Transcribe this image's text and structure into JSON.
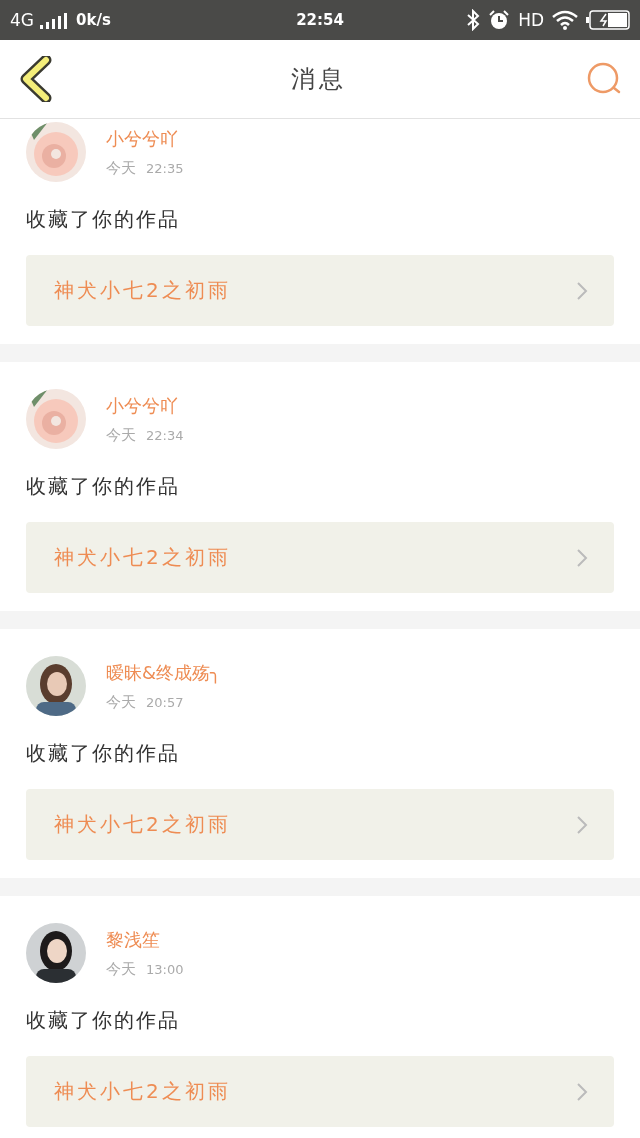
{
  "status_bar": {
    "network": "4G",
    "speed": "0k/s",
    "time": "22:54",
    "hd": "HD"
  },
  "header": {
    "title": "消息"
  },
  "messages": [
    {
      "name": "小兮兮吖",
      "date": "今天",
      "time": "22:35",
      "action": "收藏了你的作品",
      "work": "神犬小七2之初雨"
    },
    {
      "name": "小兮兮吖",
      "date": "今天",
      "time": "22:34",
      "action": "收藏了你的作品",
      "work": "神犬小七2之初雨"
    },
    {
      "name": "暧昧&终成殇╮",
      "date": "今天",
      "time": "20:57",
      "action": "收藏了你的作品",
      "work": "神犬小七2之初雨"
    },
    {
      "name": "黎浅笙",
      "date": "今天",
      "time": "13:00",
      "action": "收藏了你的作品",
      "work": "神犬小七2之初雨"
    }
  ]
}
